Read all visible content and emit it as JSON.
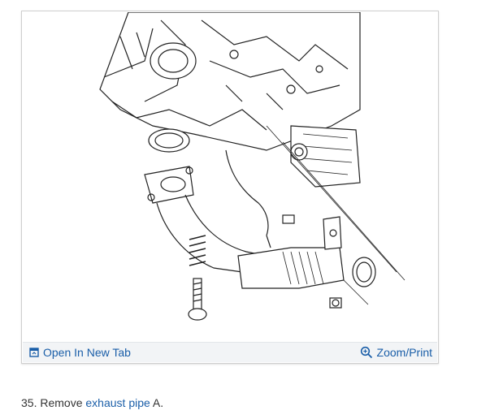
{
  "figure": {
    "toolbar": {
      "open_label": "Open In New Tab",
      "zoom_label": "Zoom/Print"
    },
    "accent_color": "#1a5ea8"
  },
  "step": {
    "number": "35.",
    "prefix": "Remove",
    "link_text": "exhaust pipe",
    "suffix": "A."
  },
  "icons": [
    "open-new-tab-icon",
    "zoom-icon"
  ]
}
